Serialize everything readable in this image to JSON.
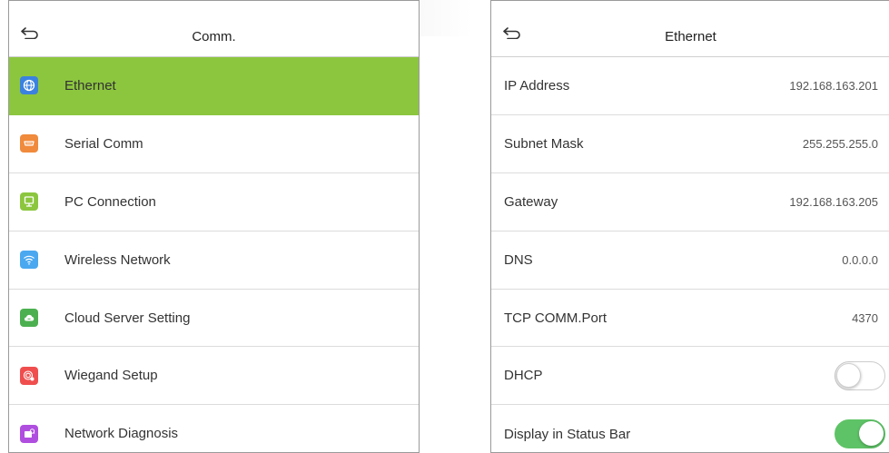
{
  "colors": {
    "accent_selected": "#8cc63f",
    "toggle_on": "#5ec366",
    "ethernet_icon": "#3b82e0",
    "serial_icon": "#f08a3c",
    "pc_icon": "#8cc63f",
    "wireless_icon": "#4aa8f0",
    "cloud_icon": "#4cb050",
    "wiegand_icon": "#f04e4e",
    "diagnosis_icon": "#b04ee0"
  },
  "comm_menu": {
    "title": "Comm.",
    "items": [
      {
        "label": "Ethernet",
        "icon": "globe-icon",
        "selected": true
      },
      {
        "label": "Serial Comm",
        "icon": "serial-port-icon"
      },
      {
        "label": "PC Connection",
        "icon": "pc-icon"
      },
      {
        "label": "Wireless Network",
        "icon": "wifi-icon"
      },
      {
        "label": "Cloud Server Setting",
        "icon": "cloud-icon"
      },
      {
        "label": "Wiegand Setup",
        "icon": "wiegand-icon"
      },
      {
        "label": "Network Diagnosis",
        "icon": "network-diagnosis-icon"
      }
    ]
  },
  "ethernet": {
    "title": "Ethernet",
    "rows": [
      {
        "label": "IP Address",
        "value": "192.168.163.201"
      },
      {
        "label": "Subnet Mask",
        "value": "255.255.255.0"
      },
      {
        "label": "Gateway",
        "value": "192.168.163.205"
      },
      {
        "label": "DNS",
        "value": "0.0.0.0"
      },
      {
        "label": "TCP COMM.Port",
        "value": "4370"
      },
      {
        "label": "DHCP",
        "toggle": false
      },
      {
        "label": "Display in Status Bar",
        "toggle": true
      }
    ]
  }
}
